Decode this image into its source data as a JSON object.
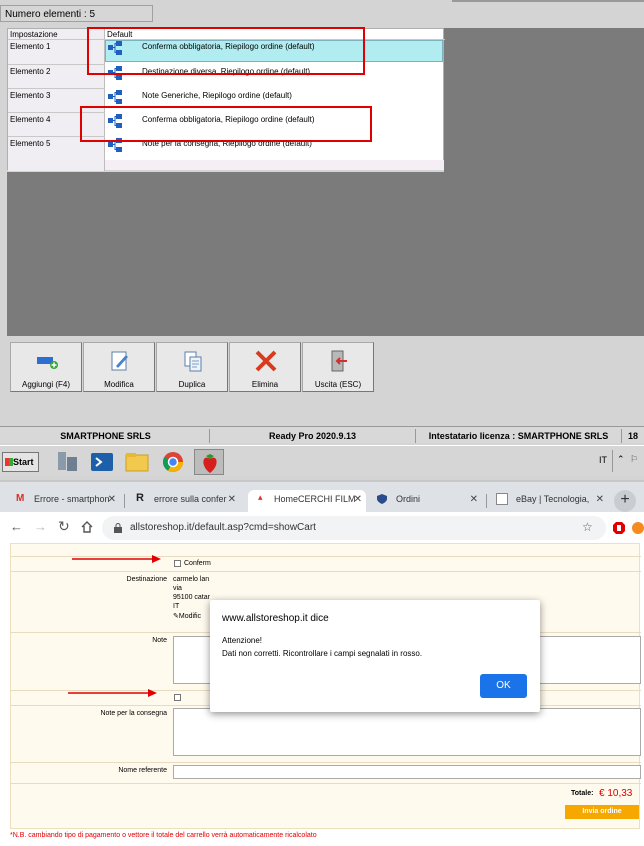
{
  "app": {
    "count_label": "Numero elementi : 5",
    "grid": {
      "header_left": "Impostazione",
      "header_right": "Default",
      "rows": [
        {
          "label": "Elemento 1",
          "value": "Conferma obbligatoria, Riepilogo ordine (default)"
        },
        {
          "label": "Elemento 2",
          "value": "Destinazione diversa, Riepilogo ordine (default)"
        },
        {
          "label": "Elemento 3",
          "value": "Note Generiche, Riepilogo ordine (default)"
        },
        {
          "label": "Elemento 4",
          "value": "Conferma obbligatoria, Riepilogo ordine (default)"
        },
        {
          "label": "Elemento 5",
          "value": "Note per la consegna, Riepilogo ordine (default)"
        }
      ]
    },
    "toolbar": {
      "add": "Aggiungi (F4)",
      "edit": "Modifica",
      "duplicate": "Duplica",
      "delete": "Elimina",
      "exit": "Uscita (ESC)"
    },
    "status": {
      "company": "SMARTPHONE SRLS",
      "version": "Ready Pro 2020.9.13",
      "license": "Intestatario licenza : SMARTPHONE SRLS",
      "extra": "18"
    }
  },
  "taskbar": {
    "start": "Start",
    "lang": "IT"
  },
  "browser": {
    "tabs": [
      {
        "label": "Errore - smartphon"
      },
      {
        "label": "errore sulla confer"
      },
      {
        "label": "HomeCERCHI FILM"
      },
      {
        "label": "Ordini"
      },
      {
        "label": "eBay | Tecnologia,"
      }
    ],
    "url": "allstoreshop.it/default.asp?cmd=showCart",
    "colors": {
      "accent": "#1a73e8",
      "price": "#e00000",
      "order_btn": "#f7a800"
    }
  },
  "page": {
    "confirm_label": "Conferm",
    "destination_label": "Destinazione",
    "destination_lines": [
      "carmelo lan",
      "via",
      "95100 catar",
      "IT"
    ],
    "modify_label": "Modific",
    "notes_label": "Note",
    "delivery_notes_label": "Note per la consegna",
    "referent_label": "Nome referente",
    "total_label": "Totale:",
    "total_value": "€ 10,33",
    "order_button": "Invia ordine",
    "footnote": "*N.B. cambiando tipo di pagamento o vettore il totale del carrello verrà automaticamente ricalcolato"
  },
  "dialog": {
    "title": "www.allstoreshop.it dice",
    "line1": "Attenzione!",
    "line2": "Dati non corretti. Ricontrollare i campi segnalati in rosso.",
    "ok": "OK"
  }
}
